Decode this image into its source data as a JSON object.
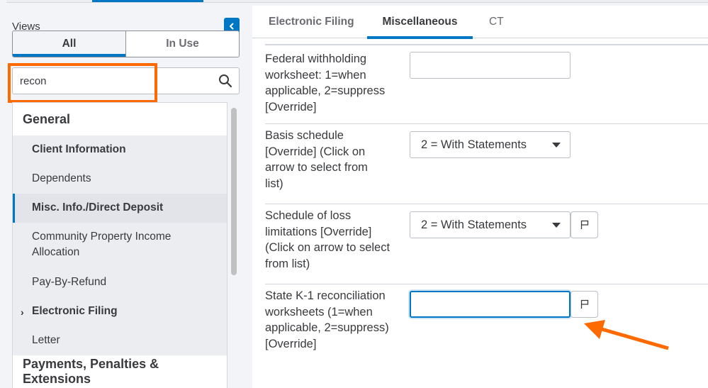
{
  "sidebar": {
    "views_label": "Views",
    "collapse_icon": "chevron-left-icon",
    "segments": [
      {
        "label": "All",
        "active": true
      },
      {
        "label": "In Use",
        "active": false
      }
    ],
    "search": {
      "value": "recon",
      "placeholder": "",
      "icon": "search-icon"
    },
    "groups": [
      {
        "label": "General",
        "items": [
          {
            "label": "Client Information",
            "bold": true,
            "selected": false
          },
          {
            "label": "Dependents",
            "bold": false,
            "selected": false
          },
          {
            "label": "Misc. Info./Direct Deposit",
            "bold": true,
            "selected": true
          },
          {
            "label": "Community Property Income Allocation",
            "bold": false,
            "selected": false
          },
          {
            "label": "Pay-By-Refund",
            "bold": false,
            "selected": false
          },
          {
            "label": "Electronic Filing",
            "bold": true,
            "selected": false,
            "expandable": true
          },
          {
            "label": "Letter",
            "bold": false,
            "selected": false
          }
        ]
      },
      {
        "label": "Payments, Penalties & Extensions",
        "items": []
      }
    ]
  },
  "main": {
    "tabs": [
      {
        "label": "Electronic Filing",
        "active": false
      },
      {
        "label": "Miscellaneous",
        "active": true
      },
      {
        "label": "CT",
        "active": false
      }
    ],
    "fields": [
      {
        "label": "Federal withholding worksheet: 1=when applicable, 2=suppress [Override]",
        "type": "text",
        "value": ""
      },
      {
        "label": "Basis schedule [Override] (Click on arrow to select from list)",
        "type": "select",
        "value": "2 = With Statements"
      },
      {
        "label": "Schedule of loss limitations [Override] (Click on arrow to select from list)",
        "type": "select",
        "value": "2 = With Statements",
        "flag_icon": "flag-icon"
      },
      {
        "label": "State K-1 reconciliation worksheets (1=when applicable, 2=suppress) [Override]",
        "type": "text",
        "value": "",
        "focused": true,
        "flag_icon": "flag-icon"
      }
    ]
  },
  "annotations": {
    "highlight_color": "#ff6a00",
    "arrow_color": "#ff6a00"
  },
  "colors": {
    "accent": "#0077c5",
    "text": "#393a3d",
    "muted_text": "#6b6c72"
  }
}
